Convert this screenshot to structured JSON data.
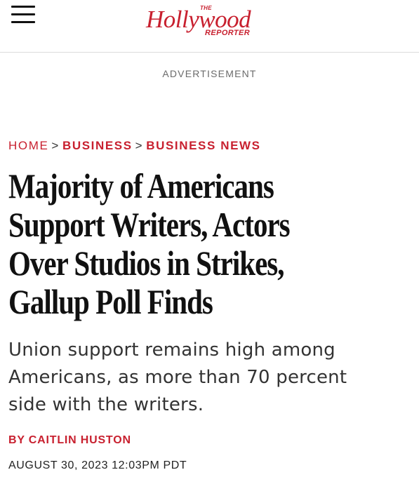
{
  "header": {
    "menu_icon": "hamburger-menu-icon",
    "logo": {
      "the": "THE",
      "main": "Hollywood",
      "reporter": "REPORTER"
    }
  },
  "ad_label": "ADVERTISEMENT",
  "breadcrumb": {
    "home": "HOME",
    "separator": ">",
    "items": [
      "BUSINESS",
      "BUSINESS NEWS"
    ]
  },
  "article": {
    "headline": {
      "line1": "Majority of Americans",
      "line2": "Support Writers, Actors",
      "line3": "Over Studios in Strikes,",
      "line4": "Gallup Poll Finds"
    },
    "dek": {
      "line1": "Union support remains high among",
      "line2": "Americans, as more than 70 percent",
      "line3": "side with the writers."
    },
    "byline_prefix": "BY",
    "author": "CAITLIN HUSTON",
    "date": "AUGUST 30, 2023 12:03PM PDT"
  },
  "colors": {
    "brand_red": "#c8202f",
    "text": "#111111",
    "muted": "#6b6b6b"
  }
}
